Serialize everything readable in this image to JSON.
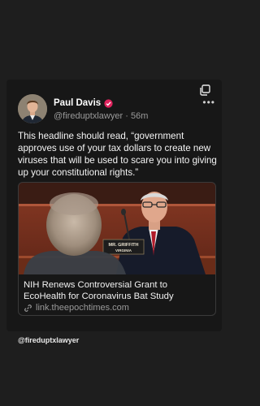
{
  "post": {
    "author_name": "Paul Davis",
    "author_handle": "@fireduptxlawyer",
    "separator": "·",
    "time_ago": "56m",
    "text": "This headline should read, “government approves use of your tax dollars to create new viruses that will be used to scare you into giving up your constitutional rights.”",
    "link": {
      "title": "NIH Renews Controversial Grant to EcoHealth for Coronavirus Bat Study",
      "domain": "link.theepochtimes.com",
      "placard_line1": "MR. GRIFFITH",
      "placard_line2": "VIRGINIA"
    }
  },
  "footer": {
    "handle": "@fireduptxlawyer"
  },
  "colors": {
    "background": "#1e1e1e",
    "card": "#171717",
    "verified_badge": "#e0245e",
    "muted_text": "#9a9a9a"
  },
  "icons": [
    "copy-icon",
    "more-icon",
    "verified-icon",
    "link-icon"
  ]
}
